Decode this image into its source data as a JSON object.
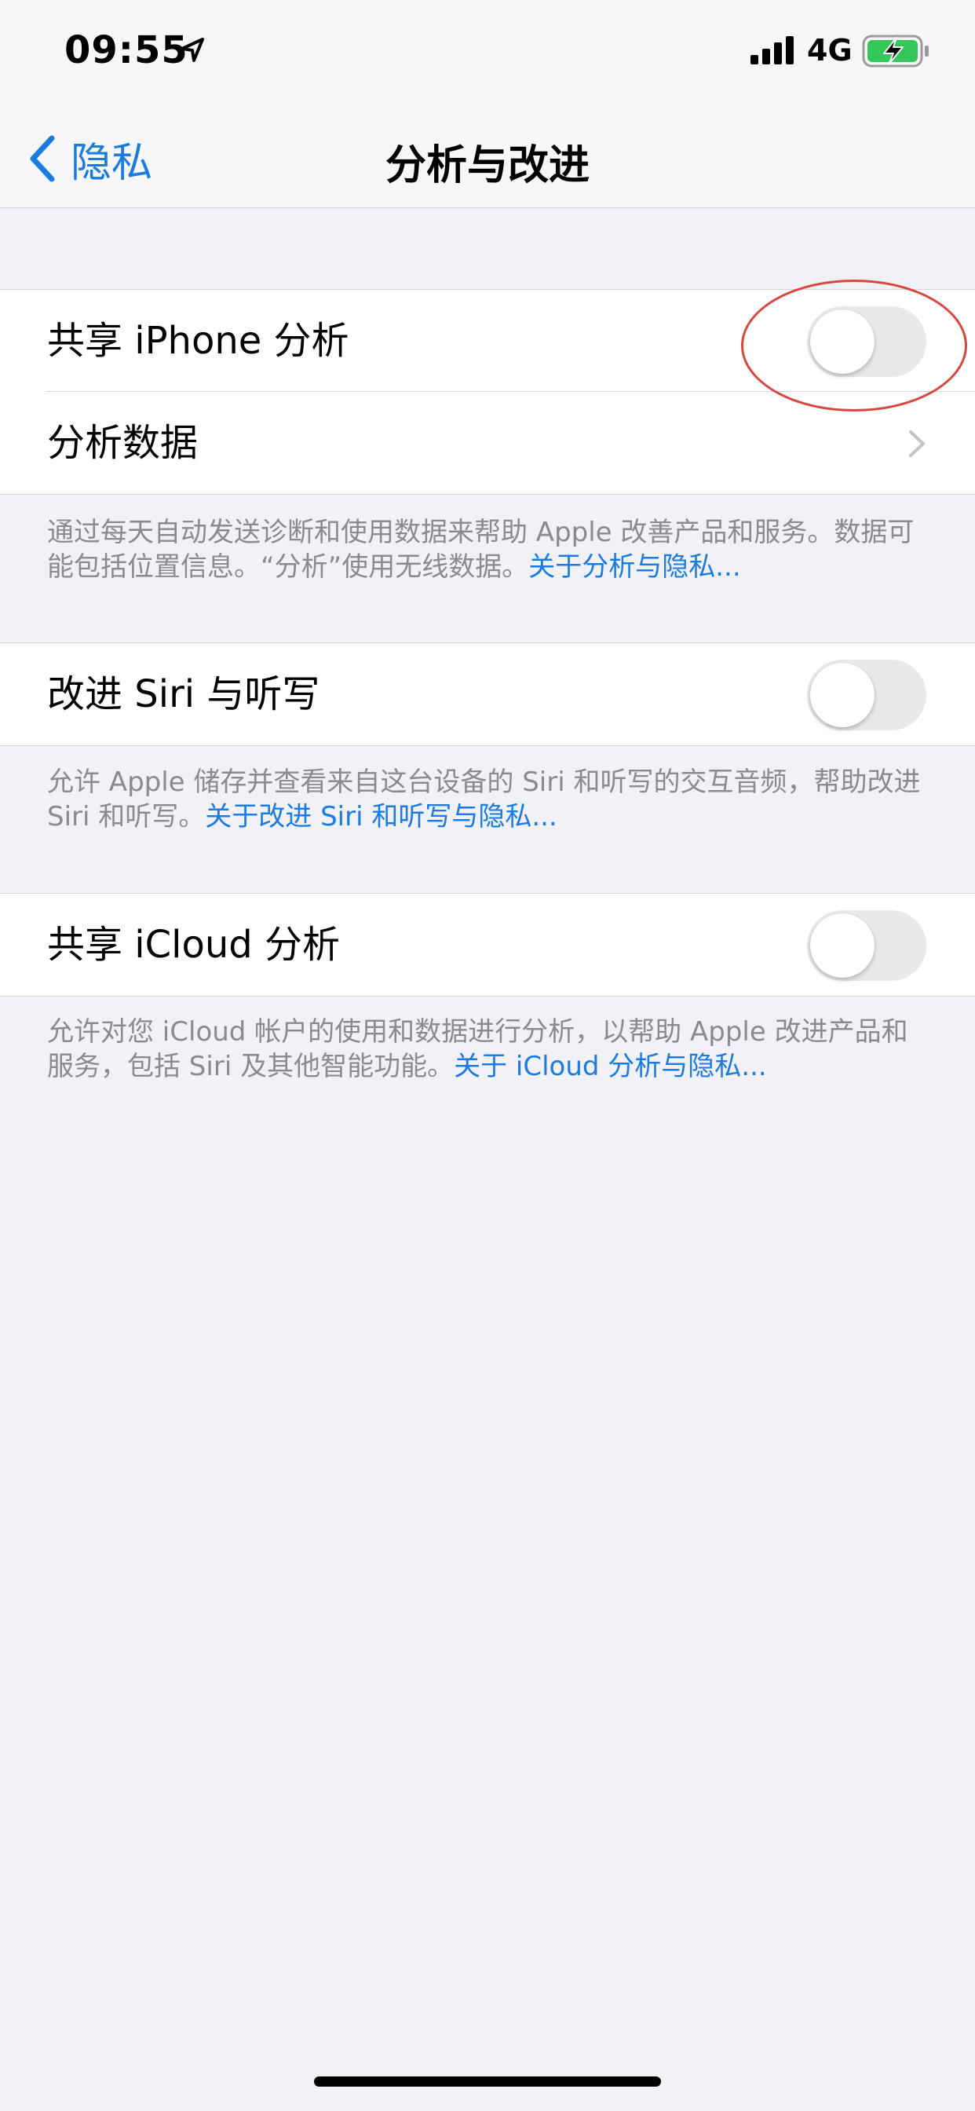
{
  "status_bar": {
    "time": "09:55",
    "network": "4G"
  },
  "nav": {
    "back_label": "隐私",
    "title": "分析与改进"
  },
  "groups": [
    {
      "rows": [
        {
          "label": "共享 iPhone 分析",
          "control": "toggle",
          "on": false
        },
        {
          "label": "分析数据",
          "control": "chevron"
        }
      ],
      "footer": "通过每天自动发送诊断和使用数据来帮助 Apple 改善产品和服务。数据可能包括位置信息。“分析”使用无线数据。",
      "footer_link": "关于分析与隐私..."
    },
    {
      "rows": [
        {
          "label": "改进 Siri 与听写",
          "control": "toggle",
          "on": false
        }
      ],
      "footer": "允许 Apple 储存并查看来自这台设备的 Siri 和听写的交互音频，帮助改进 Siri 和听写。",
      "footer_link": "关于改进 Siri 和听写与隐私..."
    },
    {
      "rows": [
        {
          "label": "共享 iCloud 分析",
          "control": "toggle",
          "on": false
        }
      ],
      "footer": "允许对您 iCloud 帐户的使用和数据进行分析，以帮助 Apple 改进产品和服务，包括 Siri 及其他智能功能。",
      "footer_link": "关于 iCloud 分析与隐私..."
    }
  ],
  "colors": {
    "accent": "#1a7ce0",
    "background": "#f1f1f6",
    "annotation": "#d9463e",
    "battery_charging": "#34c759"
  }
}
